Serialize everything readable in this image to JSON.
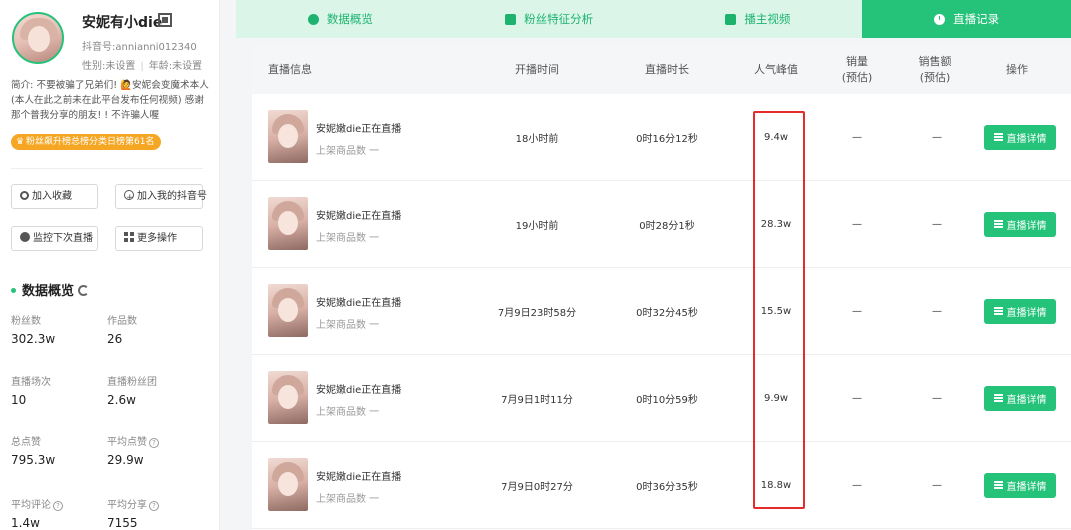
{
  "profile": {
    "name": "安妮有小die",
    "douyin_id": "抖音号:annianni012340",
    "gender": "性别:未设置",
    "age": "年龄:未设置",
    "bio": "简介: 不要被骗了兄弟们! 🙋安妮会变魔术本人 (本人在此之前未在此平台发布任何视频) 感谢那个普我分享的朋友! ! 不许骗人喔",
    "rank_badge": "粉丝飙升榜总榜分类日榜第61名"
  },
  "actions": {
    "add_favorite": "加入收藏",
    "add_my_account": "加入我的抖音号",
    "monitor_live": "监控下次直播",
    "more_actions": "更多操作"
  },
  "overview": {
    "title": "数据概览",
    "stats": [
      {
        "label": "粉丝数",
        "value": "302.3w"
      },
      {
        "label": "作品数",
        "value": "26"
      },
      {
        "label": "直播场次",
        "value": "10"
      },
      {
        "label": "直播粉丝团",
        "value": "2.6w"
      },
      {
        "label": "总点赞",
        "value": "795.3w"
      },
      {
        "label": "平均点赞",
        "value": "29.9w"
      },
      {
        "label": "平均评论",
        "value": "1.4w"
      },
      {
        "label": "平均分享",
        "value": "7155"
      }
    ]
  },
  "tabs": [
    {
      "label": "数据概览",
      "icon": "pie-chart-icon"
    },
    {
      "label": "粉丝特征分析",
      "icon": "person-card-icon"
    },
    {
      "label": "播主视频",
      "icon": "video-icon"
    },
    {
      "label": "直播记录",
      "icon": "clock-icon",
      "active": true
    }
  ],
  "table": {
    "headers": {
      "info": "直播信息",
      "start": "开播时间",
      "duration": "直播时长",
      "peak": "人气峰值",
      "sales": "销量",
      "sales_sub": "(预估)",
      "revenue": "销售额",
      "revenue_sub": "(预估)",
      "op": "操作"
    },
    "rows": [
      {
        "title": "安妮嫩die正在直播",
        "sub": "上架商品数 一",
        "start": "18小时前",
        "duration": "0时16分12秒",
        "peak": "9.4w",
        "sales": "—",
        "revenue": "—",
        "button": "直播详情"
      },
      {
        "title": "安妮嫩die正在直播",
        "sub": "上架商品数 一",
        "start": "19小时前",
        "duration": "0时28分1秒",
        "peak": "28.3w",
        "sales": "—",
        "revenue": "—",
        "button": "直播详情"
      },
      {
        "title": "安妮嫩die正在直播",
        "sub": "上架商品数 一",
        "start": "7月9日23时58分",
        "duration": "0时32分45秒",
        "peak": "15.5w",
        "sales": "—",
        "revenue": "—",
        "button": "直播详情"
      },
      {
        "title": "安妮嫩die正在直播",
        "sub": "上架商品数 一",
        "start": "7月9日1时11分",
        "duration": "0时10分59秒",
        "peak": "9.9w",
        "sales": "—",
        "revenue": "—",
        "button": "直播详情"
      },
      {
        "title": "安妮嫩die正在直播",
        "sub": "上架商品数 一",
        "start": "7月9日0时27分",
        "duration": "0时36分35秒",
        "peak": "18.8w",
        "sales": "—",
        "revenue": "—",
        "button": "直播详情"
      }
    ]
  },
  "colors": {
    "accent": "#25c27a",
    "highlight": "#e62b2b",
    "badge": "#f5a623"
  }
}
